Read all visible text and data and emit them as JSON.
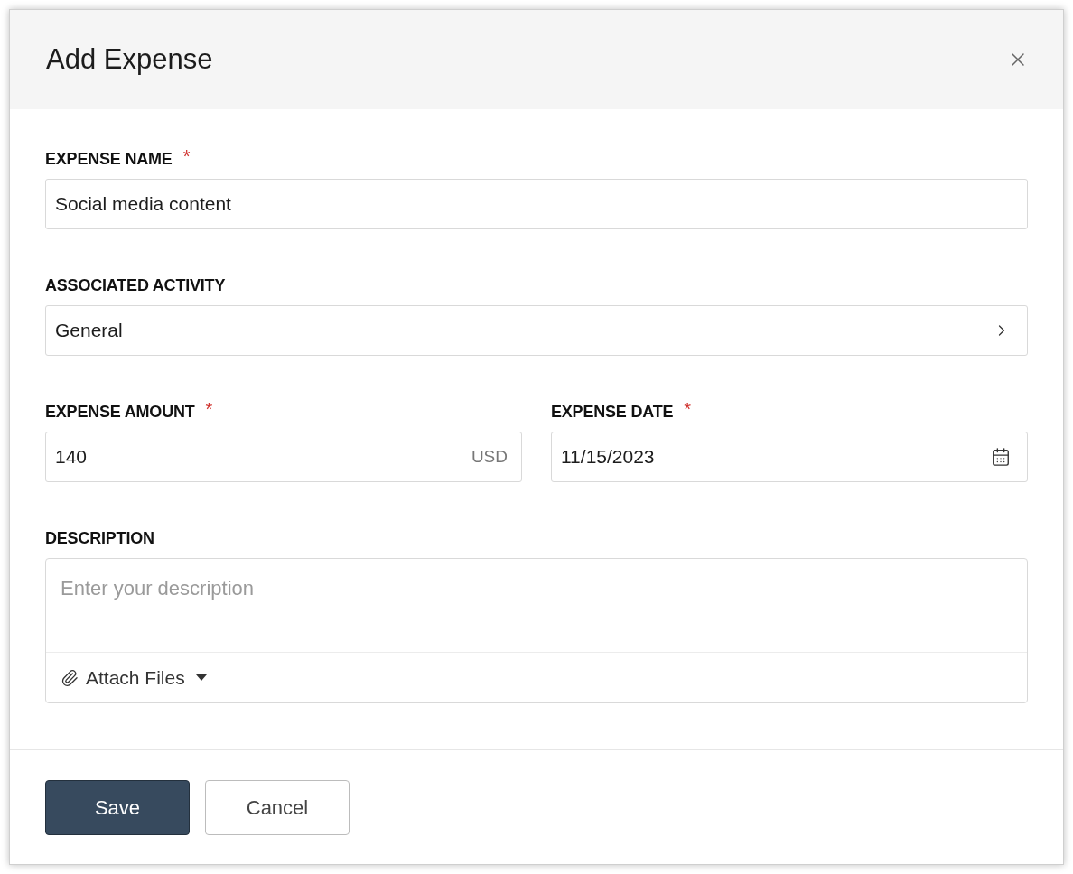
{
  "dialog": {
    "title": "Add Expense"
  },
  "fields": [
    {
      "kind": "text",
      "label": "EXPENSE NAME",
      "required_mark": "*",
      "value": "Social media content"
    },
    {
      "kind": "select",
      "label": "ASSOCIATED ACTIVITY",
      "value": "General"
    },
    {
      "kind": "amount",
      "label": "EXPENSE AMOUNT",
      "required_mark": "*",
      "value": "140",
      "suffix": "USD"
    },
    {
      "kind": "date",
      "label": "EXPENSE DATE",
      "required_mark": "*",
      "value": "11/15/2023"
    },
    {
      "kind": "textarea",
      "label": "DESCRIPTION",
      "placeholder": "Enter your description",
      "attach": "Attach Files"
    }
  ],
  "buttons": [
    {
      "kind": "primary",
      "label": "Save"
    },
    {
      "kind": "secondary",
      "label": "Cancel"
    }
  ]
}
